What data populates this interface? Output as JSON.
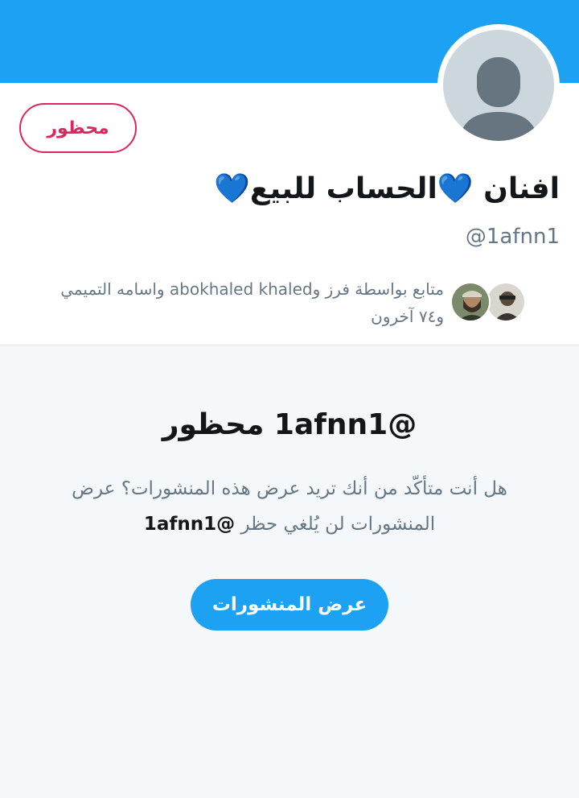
{
  "colors": {
    "banner": "#1da1f2",
    "accent": "#1da1f2",
    "blocked": "#e0245e",
    "text_primary": "#14171a",
    "text_secondary": "#657786"
  },
  "profile": {
    "blocked_label": "محظور",
    "display_name": "افنان 💙الحساب للبيع💙",
    "handle": "@1afnn1",
    "avatar_icon": "default-avatar-icon",
    "followers_known_line1": "متابع بواسطة فرز وabokhaled khaled واسامه التميمي",
    "followers_known_line2": "و٧٤ آخرون"
  },
  "blocked_notice": {
    "title": "@1afnn1 محظور",
    "description_text": "هل أنت متأكّد من أنك تريد عرض هذه المنشورات؟ عرض المنشورات لن يُلغي حظر ",
    "description_handle": "@1afnn1",
    "view_posts_label": "عرض المنشورات"
  }
}
